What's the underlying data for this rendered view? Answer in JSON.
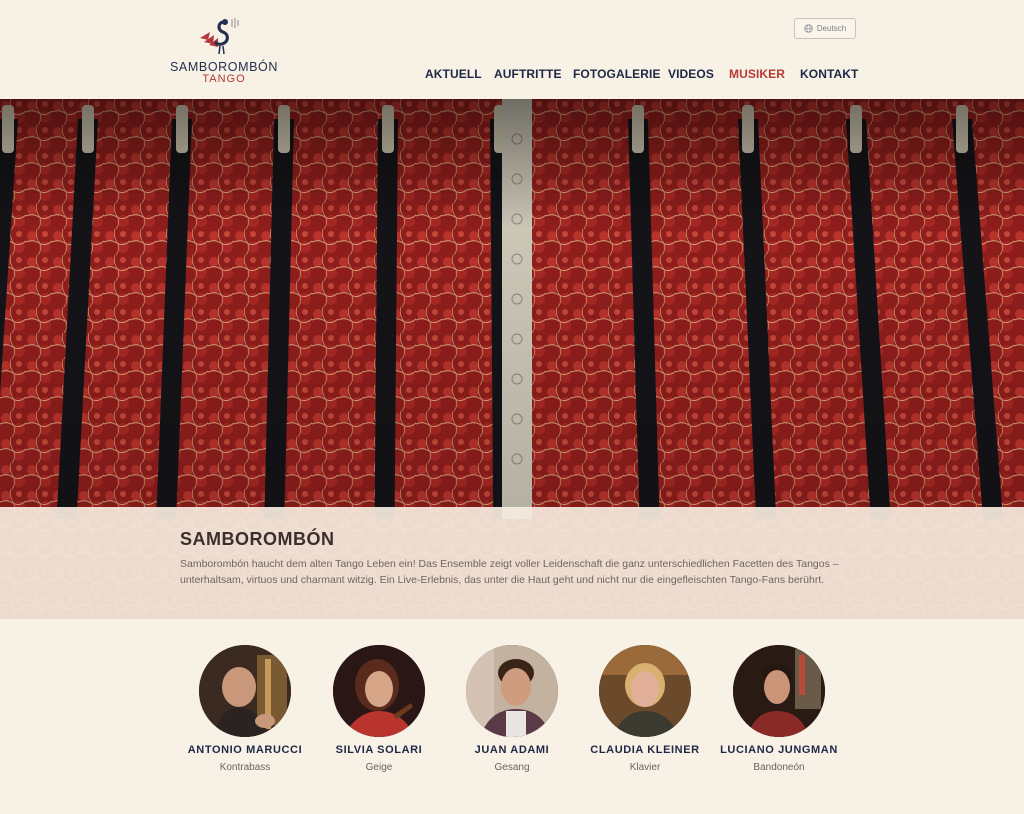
{
  "header": {
    "logo_name": "SAMBOROMBÓN",
    "logo_sub": "TANGO",
    "language_label": "Deutsch",
    "nav": [
      {
        "label": "AKTUELL",
        "active": false
      },
      {
        "label": "AUFTRITTE",
        "active": false
      },
      {
        "label": "FOTOGALERIE",
        "active": false
      },
      {
        "label": "VIDEOS",
        "active": false
      },
      {
        "label": "MUSIKER",
        "active": true
      },
      {
        "label": "KONTAKT",
        "active": false
      }
    ]
  },
  "hero": {
    "title": "SAMBOROMBÓN",
    "text": "Samborombón haucht dem alten Tango Leben ein! Das Ensemble zeigt voller Leidenschaft die ganz unterschiedlichen Facetten des Tangos – unterhaltsam, virtuos und charmant witzig. Ein Live-Erlebnis, das unter die Haut geht und nicht nur die eingefleischten Tango-Fans berührt."
  },
  "musicians": [
    {
      "name": "ANTONIO MARUCCI",
      "instrument": "Kontrabass"
    },
    {
      "name": "SILVIA SOLARI",
      "instrument": "Geige"
    },
    {
      "name": "JUAN ADAMI",
      "instrument": "Gesang"
    },
    {
      "name": "CLAUDIA KLEINER",
      "instrument": "Klavier"
    },
    {
      "name": "LUCIANO JUNGMAN",
      "instrument": "Bandoneón"
    }
  ],
  "colors": {
    "background": "#f8f1e6",
    "nav_text": "#1e2746",
    "accent": "#b83a34"
  }
}
